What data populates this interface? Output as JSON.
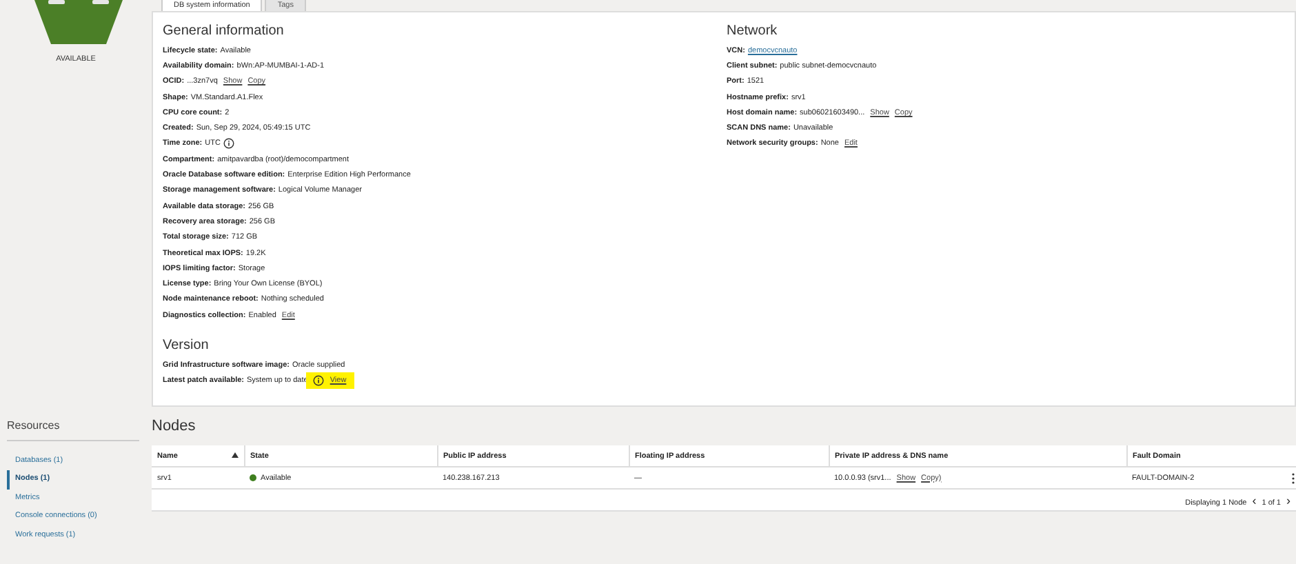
{
  "status": {
    "label": "AVAILABLE"
  },
  "tabs": [
    {
      "label": "DB system information",
      "selected": true
    },
    {
      "label": "Tags",
      "selected": false
    }
  ],
  "sections": [
    {
      "title": "General information",
      "rows": [
        {
          "label": "Lifecycle state:",
          "parts": [
            {
              "kind": "text",
              "text": "Available"
            }
          ]
        },
        {
          "label": "Availability domain:",
          "parts": [
            {
              "kind": "text",
              "text": "bWn:AP-MUMBAI-1-AD-1"
            }
          ]
        },
        {
          "label": "OCID:",
          "parts": [
            {
              "kind": "text",
              "text": "...3zn7vq"
            },
            {
              "kind": "link",
              "text": "Show"
            },
            {
              "kind": "link",
              "text": "Copy"
            }
          ]
        },
        {
          "label": "Shape:",
          "parts": [
            {
              "kind": "text",
              "text": "VM.Standard.A1.Flex"
            }
          ]
        },
        {
          "label": "CPU core count:",
          "parts": [
            {
              "kind": "text",
              "text": "2"
            }
          ]
        },
        {
          "label": "Created:",
          "parts": [
            {
              "kind": "text",
              "text": "Sun, Sep 29, 2024, 05:49:15 UTC"
            }
          ]
        },
        {
          "label": "Time zone:",
          "parts": [
            {
              "kind": "text",
              "text": "UTC"
            },
            {
              "kind": "info"
            }
          ]
        },
        {
          "label": "Compartment:",
          "parts": [
            {
              "kind": "text",
              "text": "amitpavardba (root)/democompartment"
            }
          ]
        },
        {
          "label": "Oracle Database software edition:",
          "parts": [
            {
              "kind": "text",
              "text": "Enterprise Edition High Performance"
            }
          ]
        },
        {
          "label": "Storage management software:",
          "parts": [
            {
              "kind": "text",
              "text": "Logical Volume Manager"
            }
          ]
        },
        {
          "label": "Available data storage:",
          "parts": [
            {
              "kind": "text",
              "text": "256 GB"
            }
          ]
        },
        {
          "label": "Recovery area storage:",
          "parts": [
            {
              "kind": "text",
              "text": "256 GB"
            }
          ]
        },
        {
          "label": "Total storage size:",
          "parts": [
            {
              "kind": "text",
              "text": "712 GB"
            }
          ]
        },
        {
          "label": "Theoretical max IOPS:",
          "parts": [
            {
              "kind": "text",
              "text": "19.2K"
            }
          ]
        },
        {
          "label": "IOPS limiting factor:",
          "parts": [
            {
              "kind": "text",
              "text": "Storage"
            }
          ]
        },
        {
          "label": "License type:",
          "parts": [
            {
              "kind": "text",
              "text": "Bring Your Own License (BYOL)"
            }
          ]
        },
        {
          "label": "Node maintenance reboot:",
          "parts": [
            {
              "kind": "text",
              "text": "Nothing scheduled"
            }
          ]
        },
        {
          "label": "Diagnostics collection:",
          "parts": [
            {
              "kind": "text",
              "text": "Enabled"
            },
            {
              "kind": "link",
              "text": "Edit"
            }
          ]
        }
      ]
    },
    {
      "title": "Network",
      "rows": [
        {
          "label": "VCN:",
          "parts": [
            {
              "kind": "vcn",
              "text": "democvcnauto"
            }
          ]
        },
        {
          "label": "Client subnet:",
          "parts": [
            {
              "kind": "text",
              "text": "public subnet-democvcnauto"
            }
          ]
        },
        {
          "label": "Port:",
          "parts": [
            {
              "kind": "text",
              "text": "1521"
            }
          ]
        },
        {
          "label": "Hostname prefix:",
          "parts": [
            {
              "kind": "text",
              "text": "srv1"
            }
          ]
        },
        {
          "label": "Host domain name:",
          "parts": [
            {
              "kind": "text",
              "text": "sub06021603490..."
            },
            {
              "kind": "link",
              "text": "Show"
            },
            {
              "kind": "link",
              "text": "Copy"
            }
          ]
        },
        {
          "label": "SCAN DNS name:",
          "parts": [
            {
              "kind": "text",
              "text": "Unavailable"
            }
          ]
        },
        {
          "label": "Network security groups:",
          "parts": [
            {
              "kind": "text",
              "text": "None"
            },
            {
              "kind": "link",
              "text": "Edit"
            }
          ]
        }
      ]
    },
    {
      "title": "Version",
      "rows": [
        {
          "label": "Grid Infrastructure software image:",
          "parts": [
            {
              "kind": "text",
              "text": "Oracle supplied"
            }
          ]
        },
        {
          "label": "Latest patch available:",
          "parts": [
            {
              "kind": "text",
              "text": "System up to date"
            },
            {
              "kind": "highlight",
              "parts": [
                {
                  "kind": "info"
                },
                {
                  "kind": "link",
                  "text": "View"
                }
              ]
            }
          ]
        }
      ]
    }
  ],
  "resources": {
    "title": "Resources",
    "items": [
      {
        "label": "Databases (1)",
        "selected": false
      },
      {
        "label": "Nodes (1)",
        "selected": true
      },
      {
        "label": "Metrics",
        "selected": false
      },
      {
        "label": "Console connections (0)",
        "selected": false
      },
      {
        "label": "Work requests (1)",
        "selected": false
      }
    ]
  },
  "nodes": {
    "title": "Nodes",
    "columns": [
      {
        "label": "Name",
        "sorted": true
      },
      {
        "label": "State",
        "sorted": false
      },
      {
        "label": "Public IP address",
        "sorted": false
      },
      {
        "label": "Floating IP address",
        "sorted": false
      },
      {
        "label": "Private IP address & DNS name",
        "sorted": false
      },
      {
        "label": "Fault Domain",
        "sorted": false
      }
    ],
    "rows": [
      {
        "name": "srv1",
        "state": "Available",
        "color": "#3f7f1f",
        "public_ip": "140.238.167.213",
        "floating_ip": "—",
        "private_ip": "10.0.0.93 (srv1...",
        "private_links": [
          "Show",
          "Copy)"
        ],
        "fault_domain": "FAULT-DOMAIN-2"
      }
    ],
    "footer": {
      "count": "Displaying 1 Node",
      "prev": "‹",
      "page": "1 of 1",
      "next": "›"
    }
  }
}
